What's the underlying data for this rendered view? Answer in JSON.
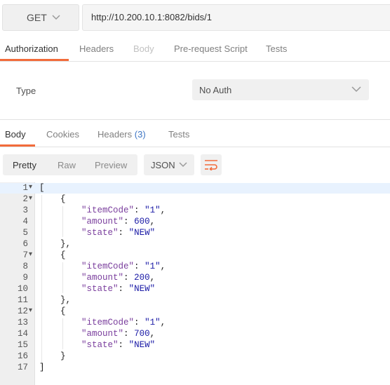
{
  "request": {
    "method": "GET",
    "url": "http://10.200.10.1:8082/bids/1"
  },
  "request_tabs": [
    {
      "label": "Authorization",
      "state": "active"
    },
    {
      "label": "Headers",
      "state": "normal"
    },
    {
      "label": "Body",
      "state": "disabled"
    },
    {
      "label": "Pre-request Script",
      "state": "normal"
    },
    {
      "label": "Tests",
      "state": "normal"
    }
  ],
  "auth": {
    "type_label": "Type",
    "type_value": "No Auth"
  },
  "response_tabs": {
    "body": "Body",
    "cookies": "Cookies",
    "headers": "Headers",
    "headers_count": "(3)",
    "tests": "Tests"
  },
  "toolbar": {
    "pretty": "Pretty",
    "raw": "Raw",
    "preview": "Preview",
    "format": "JSON",
    "wrap_icon": "wrap-lines-icon"
  },
  "colors": {
    "accent": "#f26b3a",
    "badge": "#3f77c5"
  },
  "code_lines": [
    {
      "n": "1",
      "fold": true,
      "text": "["
    },
    {
      "n": "2",
      "fold": true,
      "text": "    {"
    },
    {
      "n": "3",
      "fold": false,
      "text": "        \"itemCode\": \"1\","
    },
    {
      "n": "4",
      "fold": false,
      "text": "        \"amount\": 600,"
    },
    {
      "n": "5",
      "fold": false,
      "text": "        \"state\": \"NEW\""
    },
    {
      "n": "6",
      "fold": false,
      "text": "    },"
    },
    {
      "n": "7",
      "fold": true,
      "text": "    {"
    },
    {
      "n": "8",
      "fold": false,
      "text": "        \"itemCode\": \"1\","
    },
    {
      "n": "9",
      "fold": false,
      "text": "        \"amount\": 200,"
    },
    {
      "n": "10",
      "fold": false,
      "text": "        \"state\": \"NEW\""
    },
    {
      "n": "11",
      "fold": false,
      "text": "    },"
    },
    {
      "n": "12",
      "fold": true,
      "text": "    {"
    },
    {
      "n": "13",
      "fold": false,
      "text": "        \"itemCode\": \"1\","
    },
    {
      "n": "14",
      "fold": false,
      "text": "        \"amount\": 700,"
    },
    {
      "n": "15",
      "fold": false,
      "text": "        \"state\": \"NEW\""
    },
    {
      "n": "16",
      "fold": false,
      "text": "    }"
    },
    {
      "n": "17",
      "fold": false,
      "text": "]"
    }
  ]
}
